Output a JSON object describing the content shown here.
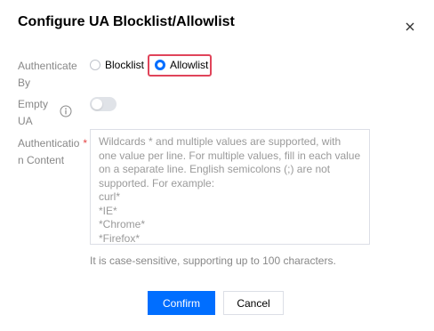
{
  "dialog": {
    "title": "Configure UA Blocklist/Allowlist",
    "close_icon": "close-icon"
  },
  "form": {
    "authenticate_by": {
      "label_line1": "Authenticate",
      "label_line2": "By",
      "options": [
        {
          "label": "Blocklist",
          "checked": false
        },
        {
          "label": "Allowlist",
          "checked": true
        }
      ]
    },
    "empty_ua": {
      "label_line1": "Empty",
      "label_line2": "UA",
      "info_icon": "info-icon",
      "enabled": false
    },
    "auth_content": {
      "label_line1": "Authenticatio",
      "label_line2": "n Content",
      "required_mark": "*",
      "placeholder": "Wildcards * and multiple values are supported, with one value per line. For multiple values, fill in each value on a separate line. English semicolons (;) are not supported. For example:\ncurl*\n*IE*\n*Chrome*\n*Firefox*",
      "hint": "It is case-sensitive, supporting up to 100 characters."
    }
  },
  "footer": {
    "confirm_label": "Confirm",
    "cancel_label": "Cancel"
  },
  "colors": {
    "accent": "#006eff",
    "highlight": "#e0445a",
    "required": "#e54545"
  }
}
